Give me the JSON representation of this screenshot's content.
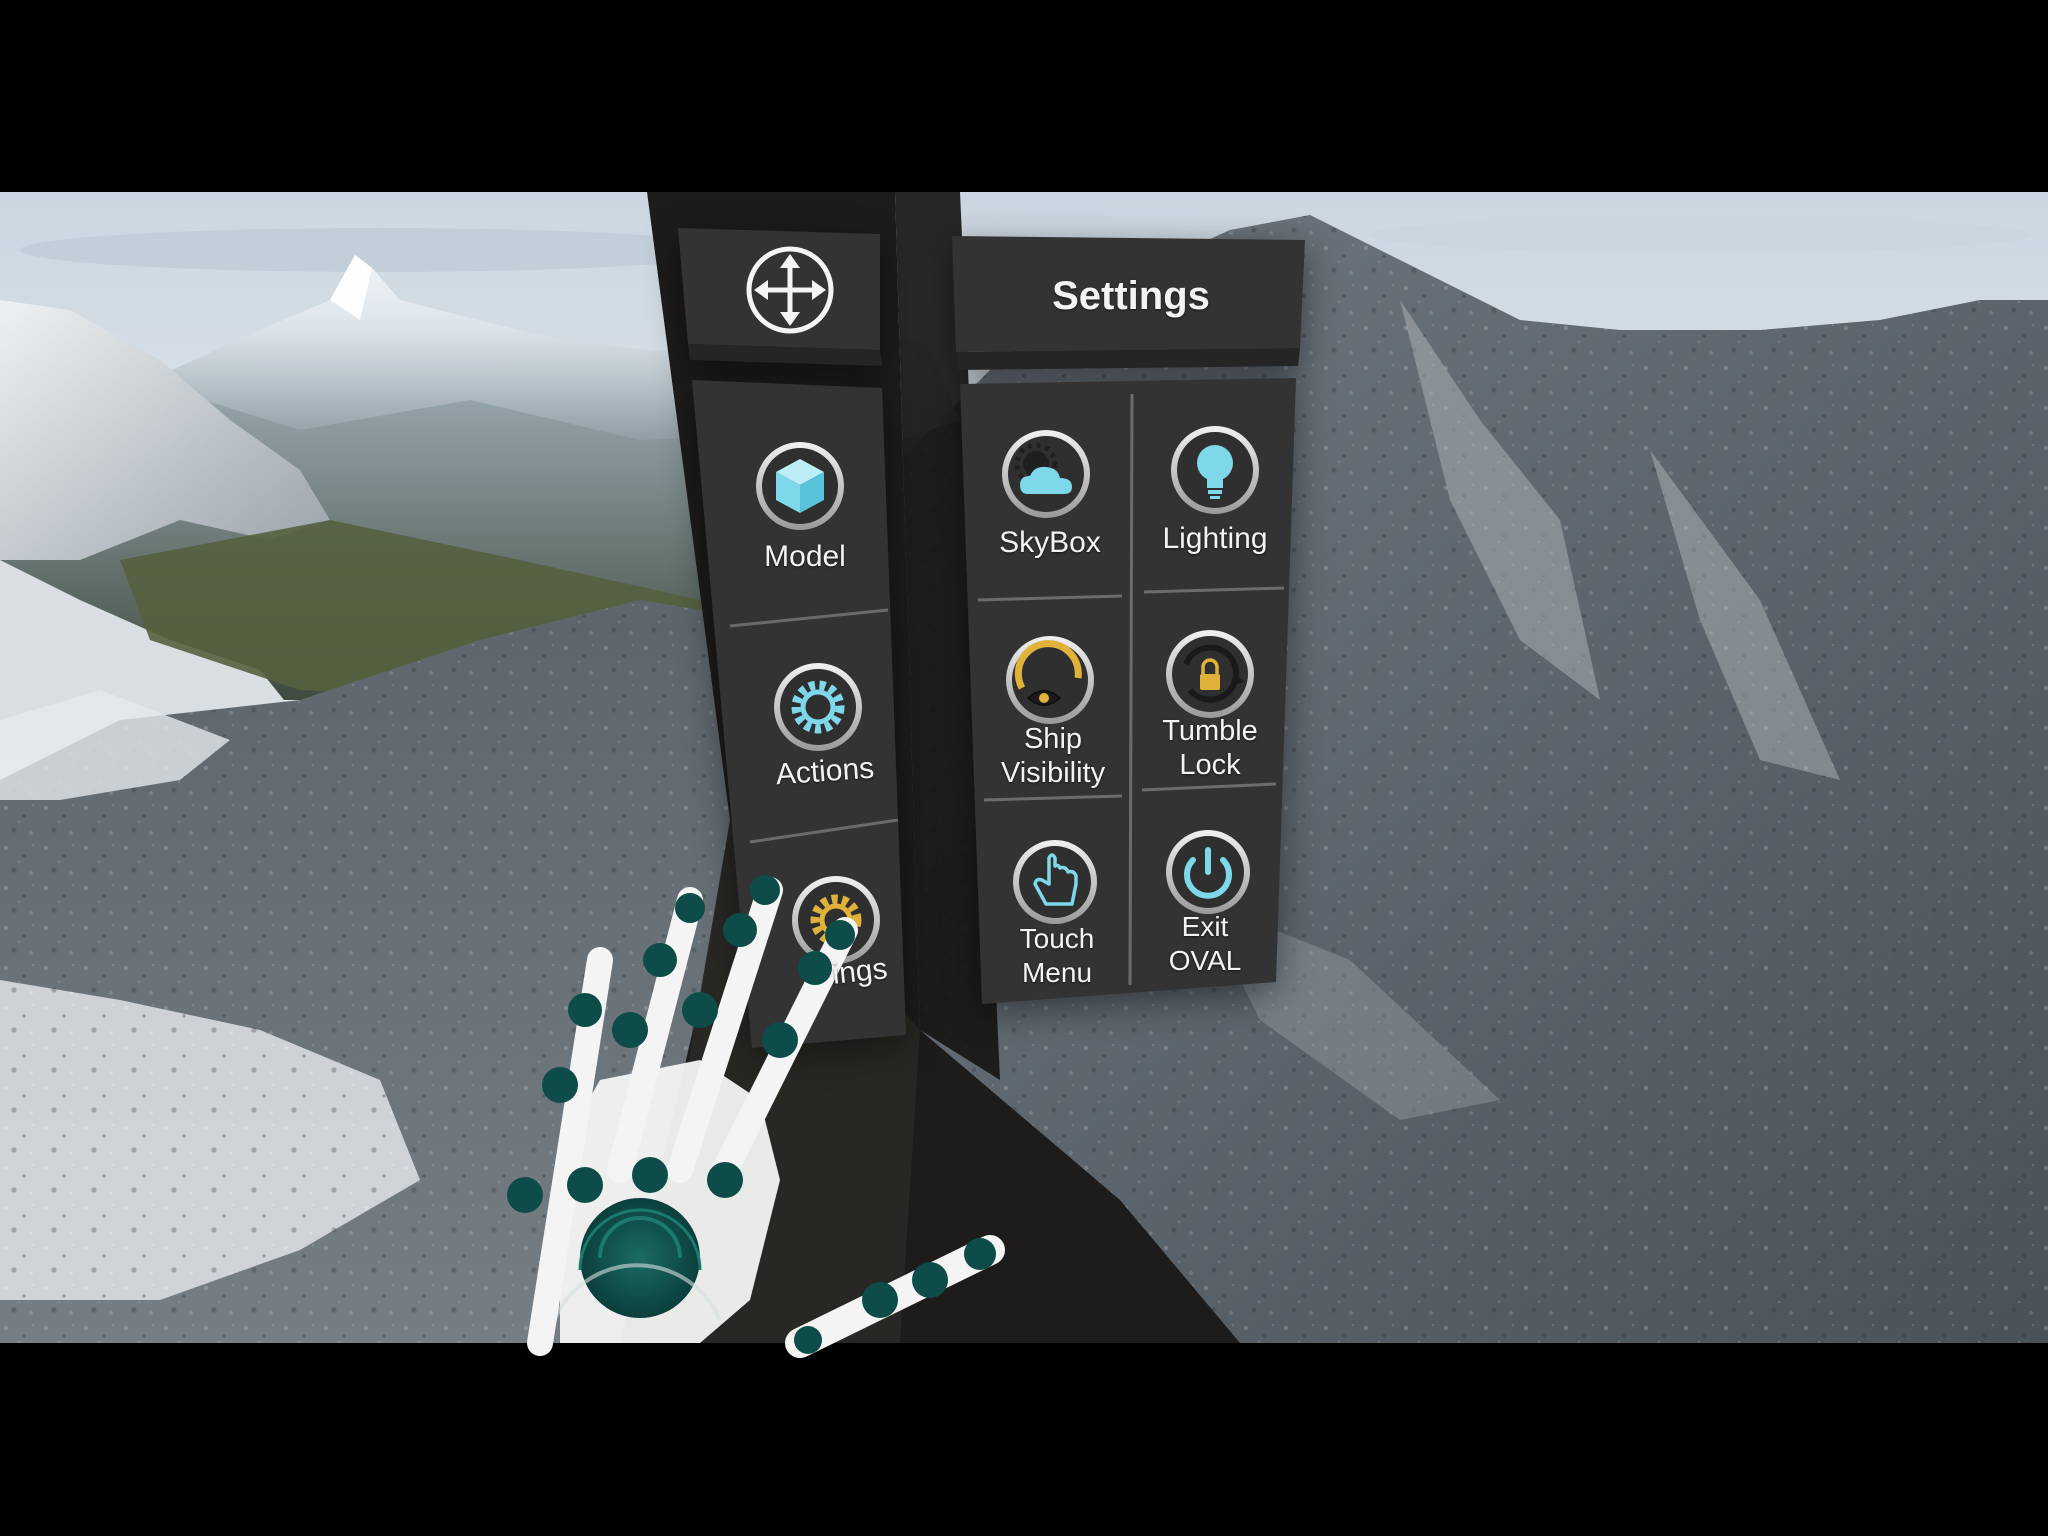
{
  "left_menu": {
    "move_control": {
      "icon": "move-arrows-icon"
    },
    "items": [
      {
        "label": "Model",
        "icon": "cube-icon"
      },
      {
        "label": "Actions",
        "icon": "gear-icon"
      },
      {
        "label": "Settings",
        "visible_label": "ings",
        "icon": "gear-gold-icon"
      }
    ]
  },
  "settings_panel": {
    "title": "Settings",
    "items": [
      {
        "label": "SkyBox",
        "icon": "sun-cloud-icon"
      },
      {
        "label": "Lighting",
        "icon": "lightbulb-icon"
      },
      {
        "label": "Ship\nVisibility",
        "icon": "eye-orbit-icon"
      },
      {
        "label": "Tumble\nLock",
        "icon": "rotate-lock-icon"
      },
      {
        "label": "Touch\nMenu",
        "icon": "pointing-hand-icon"
      },
      {
        "label": "Exit\nOVAL",
        "icon": "power-icon"
      }
    ]
  },
  "colors": {
    "panel": "#333333",
    "panel_dark": "#252525",
    "accent_cyan": "#7fd8ea",
    "accent_gold": "#e1b23a",
    "hand_teal": "#0d4c48",
    "hand_white": "#f4f4f4"
  }
}
